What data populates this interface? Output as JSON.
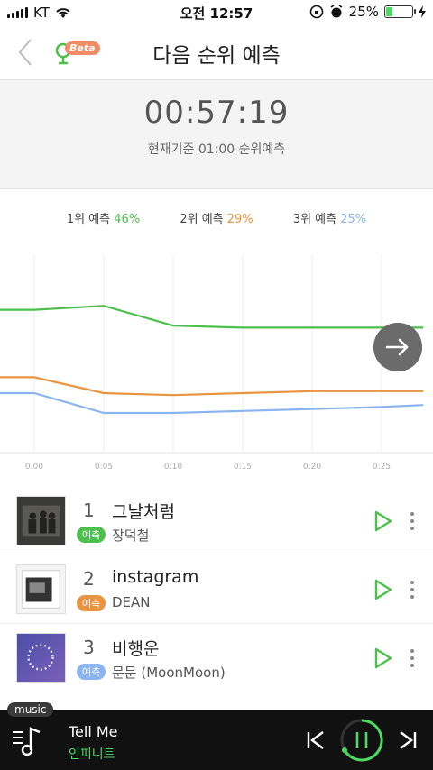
{
  "status_bar": {
    "carrier": "KT",
    "time": "오전 12:57",
    "battery": "25%"
  },
  "header": {
    "title": "다음 순위 예측",
    "beta_label": "Beta"
  },
  "countdown": {
    "timer": "00:57:19",
    "subtitle": "현재기준 01:00 순위예측"
  },
  "legend": [
    {
      "label": "1위 예측",
      "pct": "46%",
      "color": "#4cbf4c"
    },
    {
      "label": "2위 예측",
      "pct": "29%",
      "color": "#e9943e"
    },
    {
      "label": "3위 예측",
      "pct": "25%",
      "color": "#8ab4f0"
    }
  ],
  "chart_data": {
    "type": "line",
    "x": [
      "0:00",
      "0:05",
      "0:10",
      "0:15",
      "0:20",
      "0:25"
    ],
    "series": [
      {
        "color": "#4cbf4c",
        "points": [
          [
            -2.5,
            46
          ],
          [
            0,
            46
          ],
          [
            5,
            47
          ],
          [
            10,
            42
          ],
          [
            15,
            41.5
          ],
          [
            20,
            41.5
          ],
          [
            25,
            41.5
          ],
          [
            28,
            41.5
          ]
        ]
      },
      {
        "color": "#e9943e",
        "points": [
          [
            -2.5,
            29
          ],
          [
            0,
            29
          ],
          [
            5,
            25
          ],
          [
            10,
            24.5
          ],
          [
            15,
            25
          ],
          [
            20,
            25.5
          ],
          [
            25,
            25.5
          ],
          [
            28,
            25.5
          ]
        ]
      },
      {
        "color": "#8ab4f0",
        "points": [
          [
            -2.5,
            25
          ],
          [
            0,
            25
          ],
          [
            5,
            20
          ],
          [
            10,
            20
          ],
          [
            15,
            20.5
          ],
          [
            20,
            21
          ],
          [
            25,
            21.5
          ],
          [
            28,
            22
          ]
        ]
      }
    ]
  },
  "songs": [
    {
      "rank": "1",
      "tag": "예측",
      "tag_color": "#4cbf4c",
      "title": "그날처럼",
      "artist": "장덕철"
    },
    {
      "rank": "2",
      "tag": "예측",
      "tag_color": "#e9943e",
      "title": "instagram",
      "artist": "DEAN"
    },
    {
      "rank": "3",
      "tag": "예측",
      "tag_color": "#8ab4f0",
      "title": "비행운",
      "artist": "문문 (MoonMoon)"
    }
  ],
  "player": {
    "tag": "music",
    "title": "Tell Me",
    "artist": "인피니트",
    "accent": "#4cd964"
  }
}
